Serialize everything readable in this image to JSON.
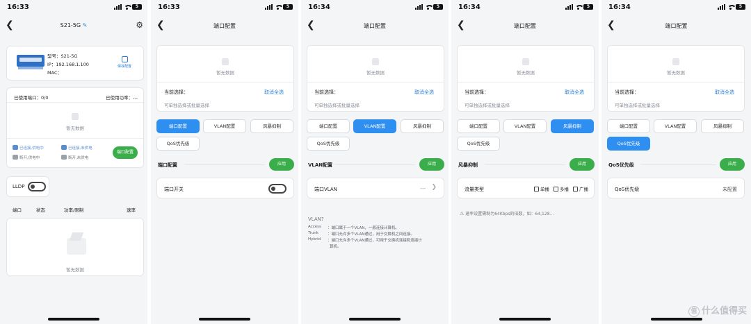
{
  "screens": [
    {
      "time": "16:33",
      "battery": "5",
      "title": "S21-5G",
      "device": {
        "model_label": "型号：S21-5G",
        "ip_label": "IP：192.168.1.100",
        "mac_label": "MAC：",
        "save_config": "保存配置"
      },
      "ports_used": "已使用端口：0/0",
      "power_used": "已使用功率：---",
      "empty": "暂无数据",
      "legend": [
        "已连接,供电中",
        "已连接,未供电",
        "断开,供电中",
        "断开,未供电"
      ],
      "port_config_button": "端口配置",
      "lldp": "LLDP",
      "columns": [
        "端口",
        "状态",
        "功率/限制",
        "速率"
      ],
      "empty2": "暂无数据"
    },
    {
      "time": "16:33",
      "battery": "5",
      "title": "端口配置",
      "empty": "暂无数据",
      "current": "当前选择：",
      "deselect": "取消全选",
      "hint": "可单独选择或批量选择",
      "tabs": [
        "端口配置",
        "VLAN配置",
        "风暴抑制",
        "QoS优先级"
      ],
      "section": "端口配置",
      "apply": "应用",
      "row_label": "端口开关"
    },
    {
      "time": "16:34",
      "battery": "5",
      "title": "端口配置",
      "empty": "暂无数据",
      "current": "当前选择：",
      "deselect": "取消全选",
      "hint": "可单独选择或批量选择",
      "tabs": [
        "端口配置",
        "VLAN配置",
        "风暴抑制",
        "QoS优先级"
      ],
      "section": "VLAN配置",
      "apply": "应用",
      "row_label": "端口VLAN",
      "row_value": "---",
      "help_title": "VLAN?",
      "help": [
        {
          "k": "Access",
          "v": "：端口属于一个VLAN，一般连接计算机。"
        },
        {
          "k": "Trunk",
          "v": "：端口允许多个VLAN通过，用于交换机之间连接。"
        },
        {
          "k": "Hybrid",
          "v": "：端口允许多个VLAN通过，可用于交换机连接和连接计"
        },
        {
          "k": "",
          "v": "算机。"
        }
      ]
    },
    {
      "time": "16:34",
      "battery": "5",
      "title": "端口配置",
      "empty": "暂无数据",
      "current": "当前选择：",
      "deselect": "取消全选",
      "hint": "可单独选择或批量选择",
      "tabs": [
        "端口配置",
        "VLAN配置",
        "风暴抑制",
        "QoS优先级"
      ],
      "section": "风暴抑制",
      "apply": "应用",
      "row_label": "流量类型",
      "options": [
        "单播",
        "多播",
        "广播"
      ],
      "note": "速率设置需制为64Kbps的倍数，如：64,128..."
    },
    {
      "time": "16:34",
      "battery": "5",
      "title": "端口配置",
      "empty": "暂无数据",
      "current": "当前选择：",
      "deselect": "取消全选",
      "hint": "可单独选择或批量选择",
      "tabs": [
        "端口配置",
        "VLAN配置",
        "风暴抑制",
        "QoS优先级"
      ],
      "section": "QoS优先级",
      "apply": "应用",
      "row_label": "QoS优先级",
      "row_value": "未配置"
    }
  ],
  "watermark": "什么值得买",
  "watermark_mark": "值",
  "colors": {
    "accent": "#2f8ff0",
    "apply_green": "#3aae4a",
    "link": "#2b7cd3"
  }
}
